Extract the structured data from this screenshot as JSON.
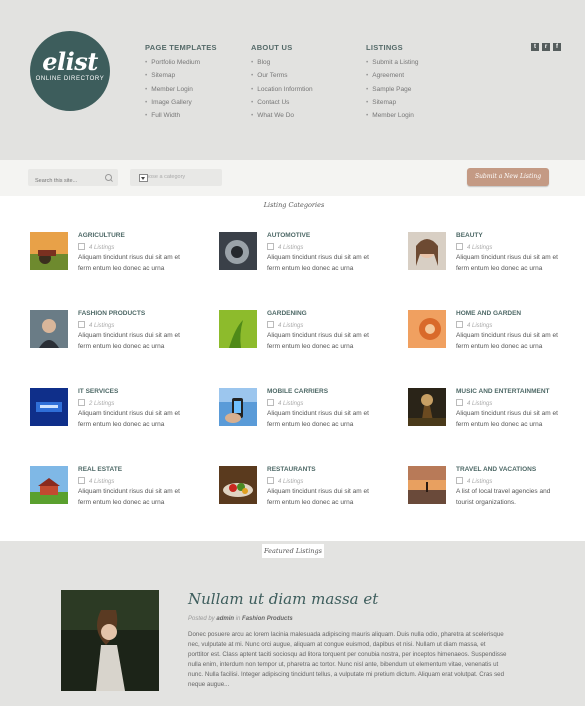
{
  "logo": {
    "title": "elist",
    "subtitle": "ONLINE DIRECTORY"
  },
  "nav": {
    "columns": [
      {
        "heading": "PAGE TEMPLATES",
        "items": [
          "Portfolio Medium",
          "Sitemap",
          "Member Login",
          "Image Gallery",
          "Full Width"
        ]
      },
      {
        "heading": "ABOUT US",
        "items": [
          "Blog",
          "Our Terms",
          "Location Informtion",
          "Contact Us",
          "What We Do"
        ]
      },
      {
        "heading": "LISTINGS",
        "items": [
          "Submit a Listing",
          "Agreement",
          "Sample Page",
          "Sitemap",
          "Member Login"
        ]
      }
    ]
  },
  "social": [
    {
      "icon": "twitter-icon",
      "glyph": "t"
    },
    {
      "icon": "rss-icon",
      "glyph": "r"
    },
    {
      "icon": "facebook-icon",
      "glyph": "f"
    }
  ],
  "toolbar": {
    "search_placeholder": "Search this site...",
    "category_placeholder": "Choose a category",
    "submit_label": "Submit a New Listing"
  },
  "categories_heading": "Listing Categories",
  "categories": [
    {
      "title": "AGRICULTURE",
      "count": "4 Listings",
      "desc": "Aliquam tincidunt risus dui sit am et ferm entum leo donec ac urna"
    },
    {
      "title": "AUTOMOTIVE",
      "count": "4 Listings",
      "desc": "Aliquam tincidunt risus dui sit am et ferm entum leo donec ac urna"
    },
    {
      "title": "BEAUTY",
      "count": "4 Listings",
      "desc": "Aliquam tincidunt risus dui sit am et ferm entum leo donec ac urna"
    },
    {
      "title": "FASHION PRODUCTS",
      "count": "4 Listings",
      "desc": "Aliquam tincidunt risus dui sit am et ferm entum leo donec ac urna"
    },
    {
      "title": "GARDENING",
      "count": "4 Listings",
      "desc": "Aliquam tincidunt risus dui sit am et ferm entum leo donec ac urna"
    },
    {
      "title": "HOME AND GARDEN",
      "count": "4 Listings",
      "desc": "Aliquam tincidunt risus dui sit am et ferm entum leo donec ac urna"
    },
    {
      "title": "IT SERVICES",
      "count": "2 Listings",
      "desc": "Aliquam tincidunt risus dui sit am et ferm entum leo donec ac urna"
    },
    {
      "title": "MOBILE CARRIERS",
      "count": "4 Listings",
      "desc": "Aliquam tincidunt risus dui sit am et ferm entum leo donec ac urna"
    },
    {
      "title": "MUSIC AND ENTERTAINMENT",
      "count": "4 Listings",
      "desc": "Aliquam tincidunt risus dui sit am et ferm entum leo donec ac urna"
    },
    {
      "title": "REAL ESTATE",
      "count": "4 Listings",
      "desc": "Aliquam tincidunt risus dui sit am et ferm entum leo donec ac urna"
    },
    {
      "title": "RESTAURANTS",
      "count": "4 Listings",
      "desc": "Aliquam tincidunt risus dui sit am et ferm entum leo donec ac urna"
    },
    {
      "title": "TRAVEL AND VACATIONS",
      "count": "4 Listings",
      "desc": "A list of local travel agencies and tourist organizations."
    }
  ],
  "featured_heading": "Featured Listings",
  "featured": {
    "title": "Nullam ut diam massa et",
    "meta_prefix": "Posted by",
    "author": "admin",
    "meta_in": "in",
    "category": "Fashion Products",
    "body": "Donec posuere arcu ac lorem lacinia malesuada adipiscing mauris aliquam. Duis nulla odio, pharetra at scelerisque nec, vulputate at mi. Nunc orci augue, aliquam at congue euismod, dapibus et nisi. Nullam ut diam massa, et porttitor est. Class aptent taciti sociosqu ad litora torquent per conubia nostra, per inceptos himenaeos. Suspendisse nulla enim, interdum non tempor ut, pharetra ac tortor. Nunc nisl ante, bibendum ut elementum vitae, venenatis ut nunc. Nulla facilisi. Integer adipiscing tincidunt tellus, a vulputate mi pretium dictum. Aliquam erat volutpat. Cras sed neque augue..."
  },
  "colors": {
    "accent": "#3d5d5c",
    "button": "#c49a84",
    "page_bg": "#e6e6e4"
  }
}
